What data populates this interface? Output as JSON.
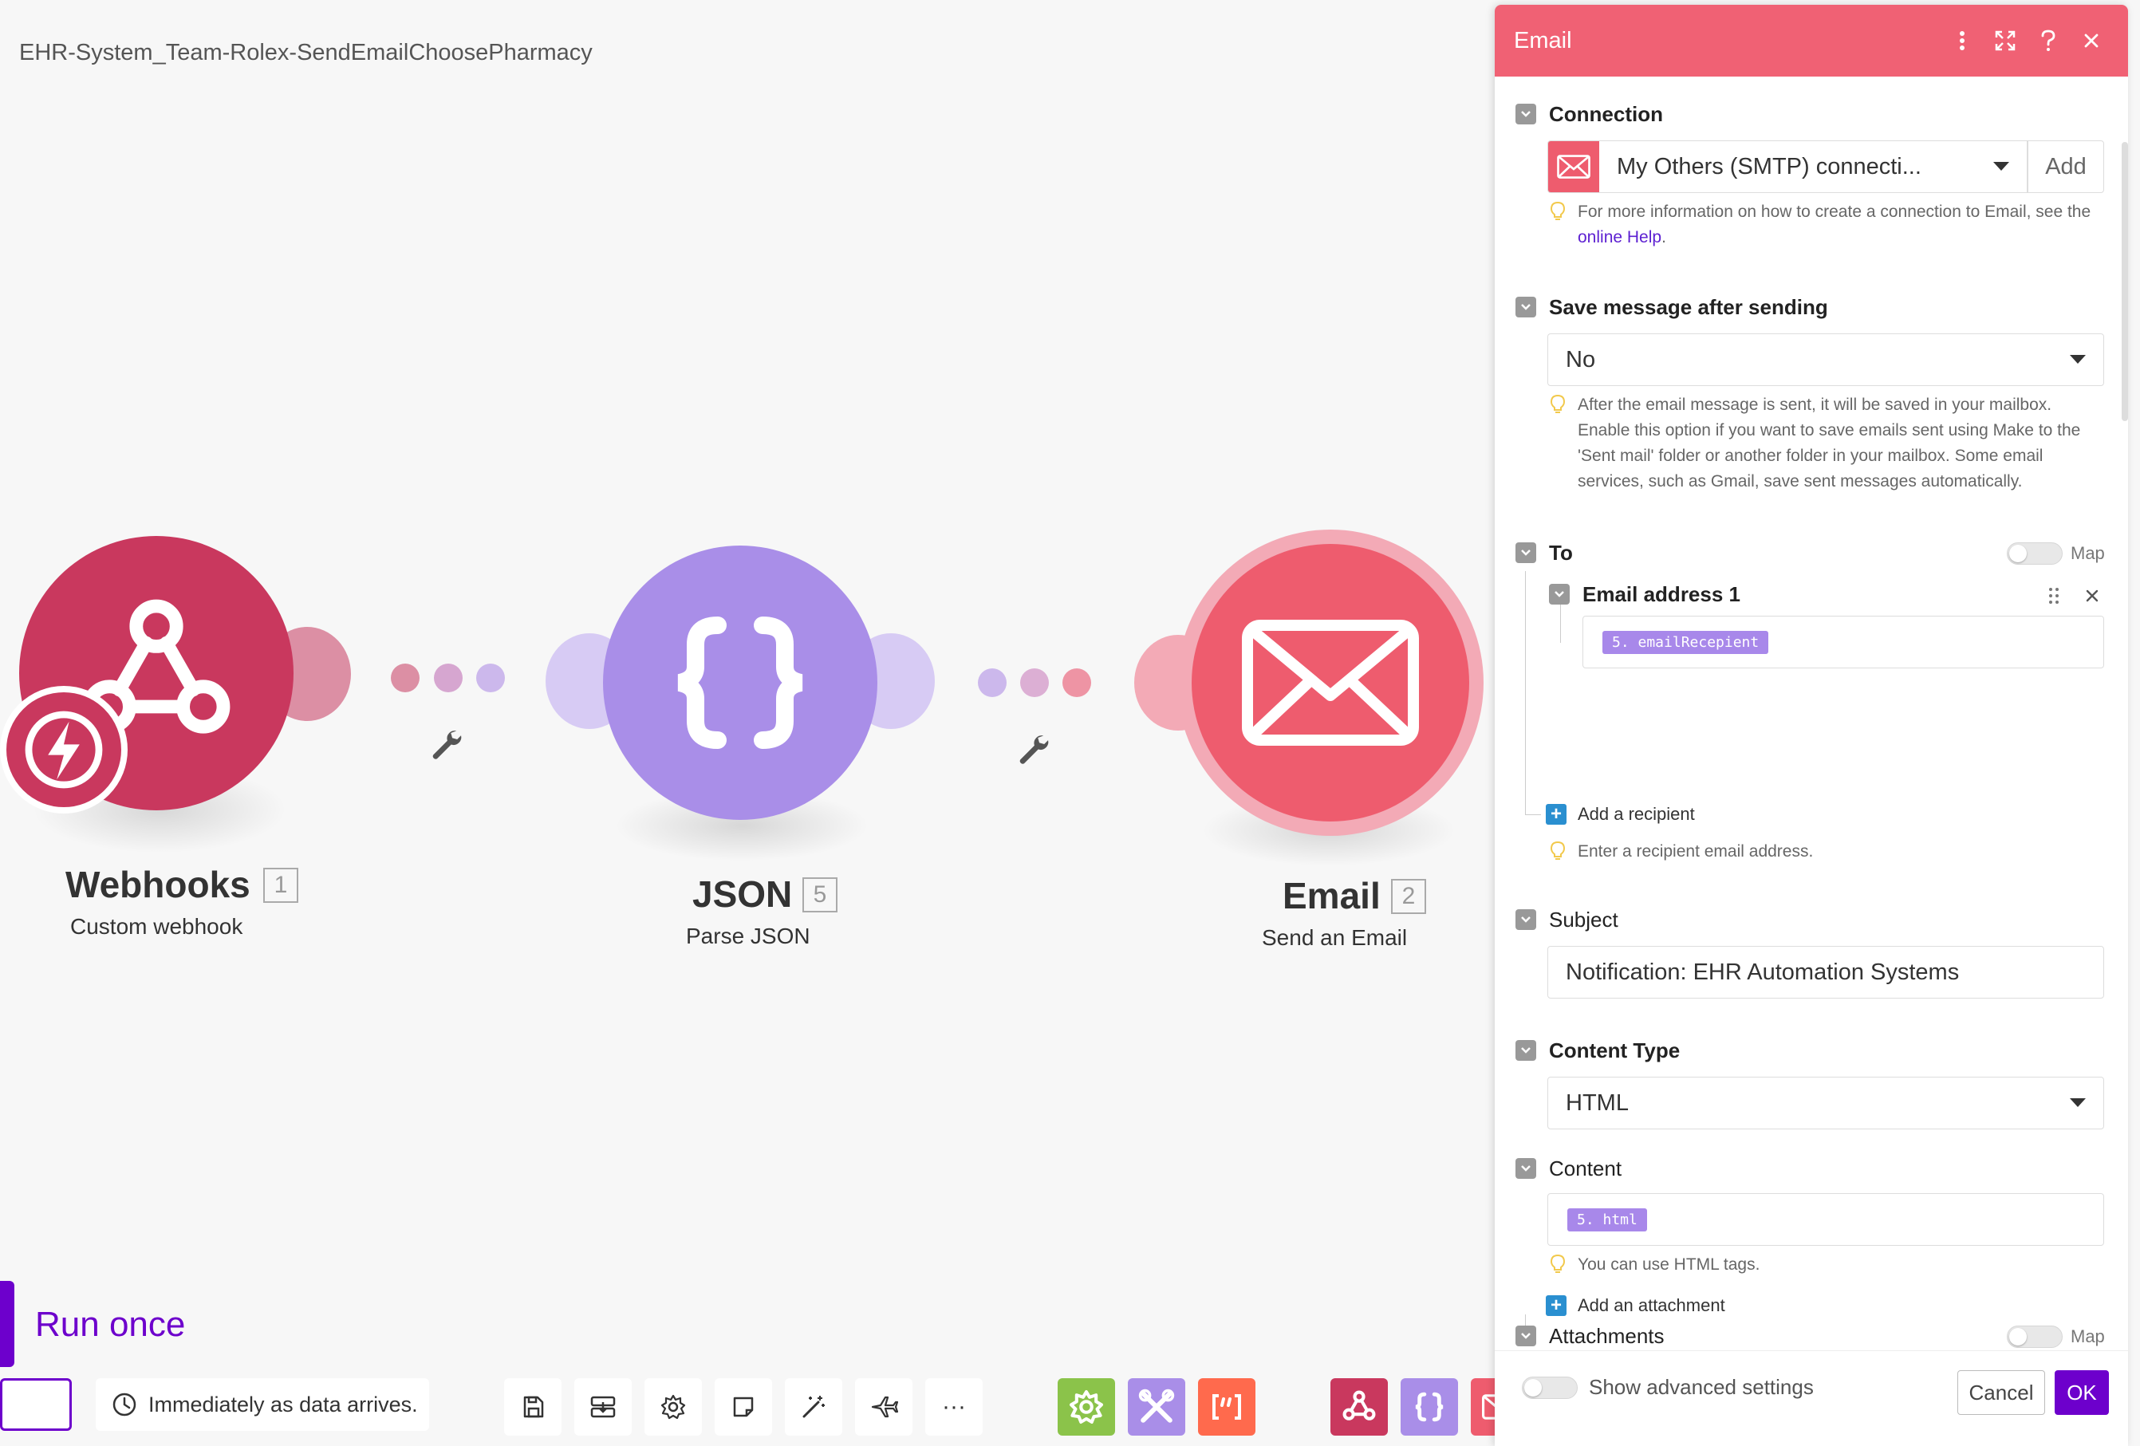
{
  "scenario": {
    "title": "EHR-System_Team-Rolex-SendEmailChoosePharmacy"
  },
  "modules": [
    {
      "name": "Webhooks",
      "number": "1",
      "subtitle": "Custom webhook",
      "color": "#c9385e",
      "icon": "webhook-icon"
    },
    {
      "name": "JSON",
      "number": "5",
      "subtitle": "Parse JSON",
      "color": "#a98ee8",
      "icon": "braces-icon"
    },
    {
      "name": "Email",
      "number": "2",
      "subtitle": "Send an Email",
      "color": "#ee5c6e",
      "icon": "envelope-icon"
    }
  ],
  "run": {
    "label": "Run once"
  },
  "toolbar": {
    "schedule_label": "Immediately as data arrives.",
    "tools": [
      "save-icon",
      "scenario-io-icon",
      "settings-icon",
      "notes-icon",
      "auto-align-icon",
      "explain-flow-icon",
      "more-icon"
    ],
    "more_label": "···",
    "apps": [
      "tools-gear-app",
      "tools-app",
      "text-parser-app",
      "webhooks-app",
      "json-app",
      "email-app"
    ]
  },
  "panel": {
    "title": "Email",
    "connection": {
      "label": "Connection",
      "value": "My Others (SMTP) connecti...",
      "add_label": "Add",
      "hint_prefix": "For more information on how to create a connection to Email, see the",
      "hint_link": "online Help",
      "hint_suffix": "."
    },
    "save_message": {
      "label": "Save message after sending",
      "value": "No",
      "hint": "After the email message is sent, it will be saved in your mailbox. Enable this option if you want to save emails sent using Make to the 'Sent mail' folder or another folder in your mailbox. Some email services, such as Gmail, save sent messages automatically."
    },
    "to": {
      "label": "To",
      "map_label": "Map",
      "item_label": "Email address 1",
      "item_value": "5. emailRecepient",
      "add_label": "Add a recipient",
      "hint": "Enter a recipient email address."
    },
    "subject": {
      "label": "Subject",
      "value": "Notification: EHR Automation Systems"
    },
    "content_type": {
      "label": "Content Type",
      "value": "HTML"
    },
    "content": {
      "label": "Content",
      "value": "5. html",
      "hint": "You can use HTML tags."
    },
    "attachments": {
      "label": "Attachments",
      "map_label": "Map",
      "add_label": "Add an attachment"
    },
    "footer": {
      "advanced_label": "Show advanced settings",
      "cancel_label": "Cancel",
      "ok_label": "OK"
    }
  },
  "colors": {
    "accent": "#6d00cc",
    "email": "#f06174",
    "json": "#a98ee8",
    "webhooks": "#c9385e",
    "help_link": "#5c1fd1"
  }
}
